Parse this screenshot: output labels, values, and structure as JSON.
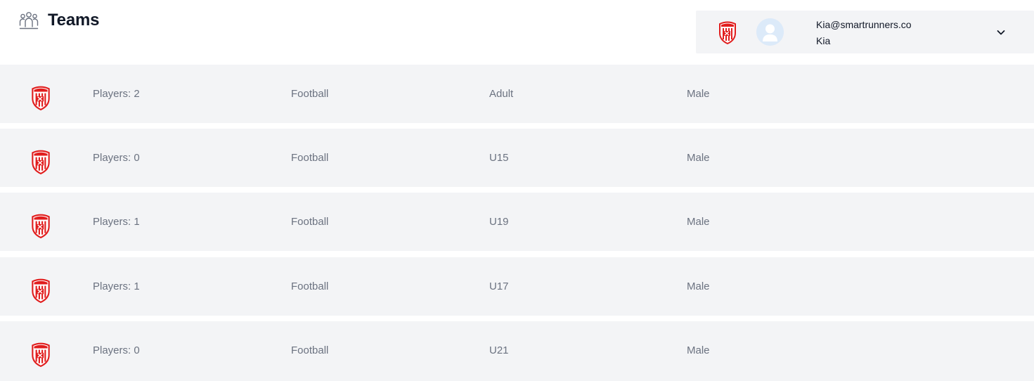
{
  "header": {
    "title": "Teams",
    "icon": "users-group-icon"
  },
  "user": {
    "email": "Kia@smartrunners.co",
    "name": "Kia"
  },
  "colors": {
    "crest_red": "#e11d1d",
    "row_bg": "#f3f4f6",
    "text_muted": "#6b7280",
    "text_dark": "#111827"
  },
  "teams": [
    {
      "players": "Players: 2",
      "sport": "Football",
      "age_group": "Adult",
      "gender": "Male"
    },
    {
      "players": "Players: 0",
      "sport": "Football",
      "age_group": "U15",
      "gender": "Male"
    },
    {
      "players": "Players: 1",
      "sport": "Football",
      "age_group": "U19",
      "gender": "Male"
    },
    {
      "players": "Players: 1",
      "sport": "Football",
      "age_group": "U17",
      "gender": "Male"
    },
    {
      "players": "Players: 0",
      "sport": "Football",
      "age_group": "U21",
      "gender": "Male"
    }
  ]
}
